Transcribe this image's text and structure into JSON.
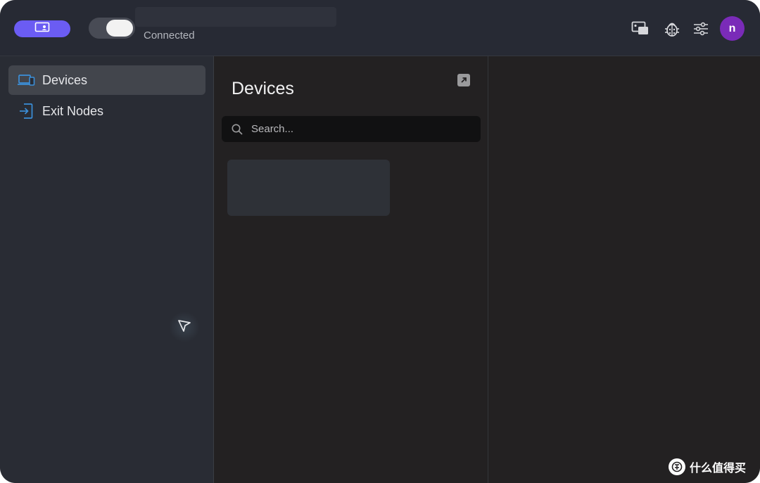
{
  "header": {
    "status": "Connected",
    "toggle_on": true,
    "avatar_initial": "n",
    "icons": [
      "device-screens-icon",
      "bug-icon",
      "sliders-icon"
    ],
    "accent": "#6b5cf3",
    "avatar_color": "#7a2bb8"
  },
  "sidebar": {
    "items": [
      {
        "label": "Devices",
        "icon": "devices-icon",
        "active": true
      },
      {
        "label": "Exit Nodes",
        "icon": "exit-nodes-icon",
        "active": false
      }
    ],
    "icon_color": "#3b8fd9"
  },
  "devices_panel": {
    "title": "Devices",
    "search_placeholder": "Search...",
    "search_value": ""
  },
  "watermark": {
    "text": "什么值得买"
  }
}
